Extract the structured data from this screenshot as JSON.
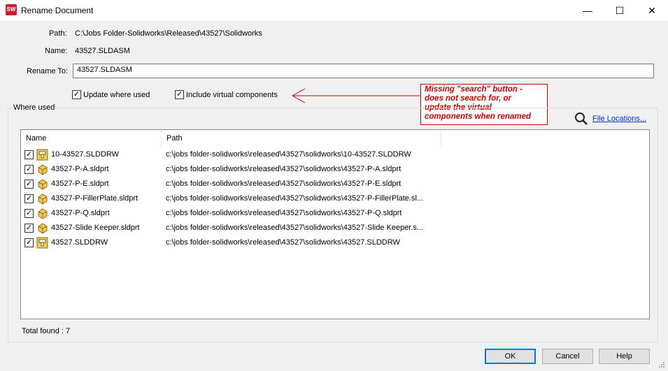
{
  "window": {
    "title": "Rename Document",
    "minimize": "—",
    "maximize": "☐",
    "close": "✕",
    "app_icon_text": "SW"
  },
  "form": {
    "path_label": "Path:",
    "path_value": "C:\\Jobs Folder-Solidworks\\Released\\43527\\Solidworks",
    "name_label": "Name:",
    "name_value": "43527.SLDASM",
    "rename_label": "Rename To:",
    "rename_value": "43527.SLDASM"
  },
  "options": {
    "update_where_used": {
      "label": "Update where used",
      "checked": true
    },
    "include_virtual": {
      "label": "Include virtual components",
      "checked": true
    }
  },
  "annotation": {
    "lines": [
      "Missing \"search\" button -",
      "does not search for, or",
      "update the virtual",
      "components when renamed"
    ],
    "color": "#d00000"
  },
  "where_used": {
    "group_label": "Where used",
    "file_locations_link": "File Locations...",
    "columns": [
      "Name",
      "Path"
    ],
    "rows": [
      {
        "checked": true,
        "type": "drawing",
        "name": "10-43527.SLDDRW",
        "path": "c:\\jobs folder-solidworks\\released\\43527\\solidworks\\10-43527.SLDDRW"
      },
      {
        "checked": true,
        "type": "part",
        "name": "43527-P-A.sldprt",
        "path": "c:\\jobs folder-solidworks\\released\\43527\\solidworks\\43527-P-A.sldprt"
      },
      {
        "checked": true,
        "type": "part",
        "name": "43527-P-E.sldprt",
        "path": "c:\\jobs folder-solidworks\\released\\43527\\solidworks\\43527-P-E.sldprt"
      },
      {
        "checked": true,
        "type": "part",
        "name": "43527-P-FillerPlate.sldprt",
        "path": "c:\\jobs folder-solidworks\\released\\43527\\solidworks\\43527-P-FillerPlate.sl..."
      },
      {
        "checked": true,
        "type": "part",
        "name": "43527-P-Q.sldprt",
        "path": "c:\\jobs folder-solidworks\\released\\43527\\solidworks\\43527-P-Q.sldprt"
      },
      {
        "checked": true,
        "type": "part",
        "name": "43527-Slide Keeper.sldprt",
        "path": "c:\\jobs folder-solidworks\\released\\43527\\solidworks\\43527-Slide Keeper.s..."
      },
      {
        "checked": true,
        "type": "drawing",
        "name": "43527.SLDDRW",
        "path": "c:\\jobs folder-solidworks\\released\\43527\\solidworks\\43527.SLDDRW"
      }
    ],
    "total_found": "Total found : 7"
  },
  "buttons": {
    "ok": "OK",
    "cancel": "Cancel",
    "help": "Help"
  }
}
